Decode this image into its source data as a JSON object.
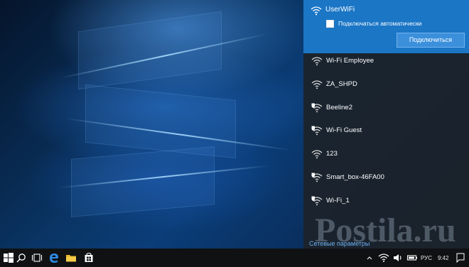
{
  "network_flyout": {
    "selected_network": {
      "name": "UserWiFi",
      "auto_connect_label": "Подключаться автоматически",
      "auto_connect_checked": false,
      "connect_button": "Подключиться"
    },
    "networks": [
      {
        "name": "Wi-Fi Employee",
        "secured": false
      },
      {
        "name": "ZA_SHPD",
        "secured": false
      },
      {
        "name": "Beeline2",
        "secured": true
      },
      {
        "name": "Wi-Fi Guest",
        "secured": true
      },
      {
        "name": "123",
        "secured": false
      },
      {
        "name": "Smart_box-46FA00",
        "secured": true
      },
      {
        "name": "Wi-Fi_1",
        "secured": true
      }
    ],
    "settings_link": "Сетевые параметры"
  },
  "watermark": {
    "text": "Postila.ru"
  },
  "taskbar": {
    "icons": [
      "windows-logo-icon",
      "search-icon",
      "task-view-icon",
      "edge-icon",
      "file-explorer-icon",
      "store-icon"
    ],
    "language": "РУС",
    "time": "9:42"
  },
  "colors": {
    "accent": "#1b76c6",
    "button": "#3b8fdb",
    "flyout_bg": "#1c222a",
    "link": "#6cb2f2",
    "taskbar": "#0f1113"
  }
}
